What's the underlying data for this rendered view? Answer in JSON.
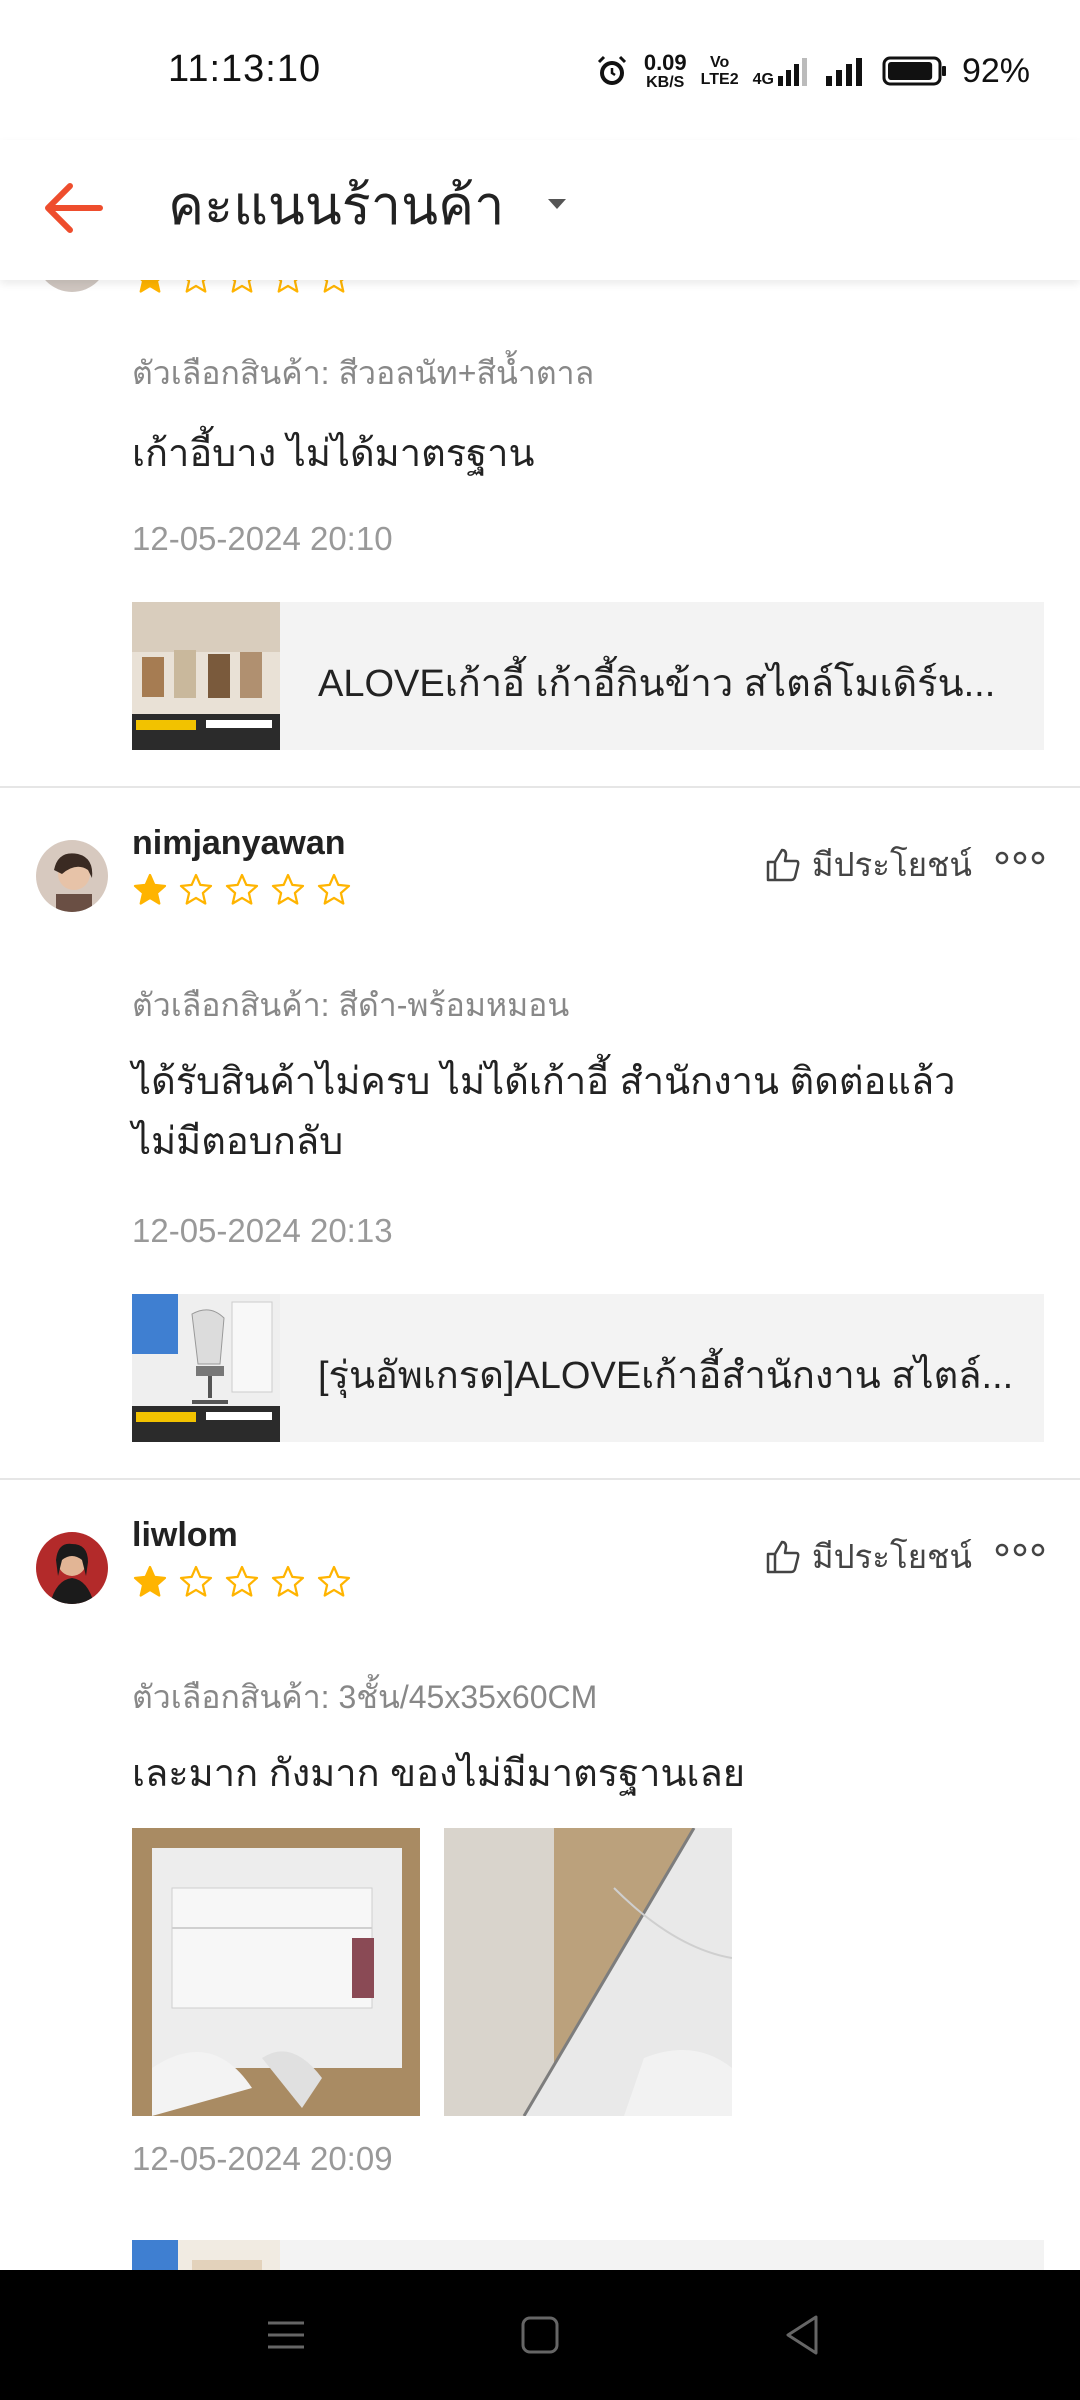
{
  "status_bar": {
    "time": "11:13:10",
    "net_speed_value": "0.09",
    "net_speed_unit": "KB/S",
    "volte_top": "Vo",
    "volte_bottom": "LTE2",
    "network_type": "4G",
    "battery_percent": "92%",
    "battery_level": 0.92
  },
  "header": {
    "title": "คะแนนร้านค้า"
  },
  "reviews": [
    {
      "rating": 1,
      "variation": "ตัวเลือกสินค้า: สีวอลนัท+สีน้ำตาล",
      "text": "เก้าอี้บาง ไม่ได้มาตรฐาน",
      "date": "12-05-2024 20:10",
      "product_name": "ALOVEเก้าอี้ เก้าอี้กินข้าว สไตล์โมเดิร์น..."
    },
    {
      "username": "nimjanyawan",
      "rating": 1,
      "helpful_label": "มีประโยชน์",
      "variation": "ตัวเลือกสินค้า: สีดำ-พร้อมหมอน",
      "text_line1": "ได้รับสินค้าไม่ครบ ไม่ได้เก้าอี้ สำนักงาน ติดต่อแล้ว",
      "text_line2": "ไม่มีตอบกลับ",
      "date": "12-05-2024 20:13",
      "product_name": "[รุ่นอัพเกรด]ALOVEเก้าอี้สำนักงาน สไตล์..."
    },
    {
      "username": "liwlom",
      "rating": 1,
      "helpful_label": "มีประโยชน์",
      "variation": "ตัวเลือกสินค้า: 3ชั้น/45x35x60CM",
      "text": "เละมาก กังมาก ของไม่มีมาตรฐานเลย",
      "date": "12-05-2024 20:09"
    }
  ],
  "colors": {
    "accent": "#ee4d2d",
    "star": "#ffb400",
    "muted_text": "#888888",
    "product_bg": "#f3f3f3"
  }
}
